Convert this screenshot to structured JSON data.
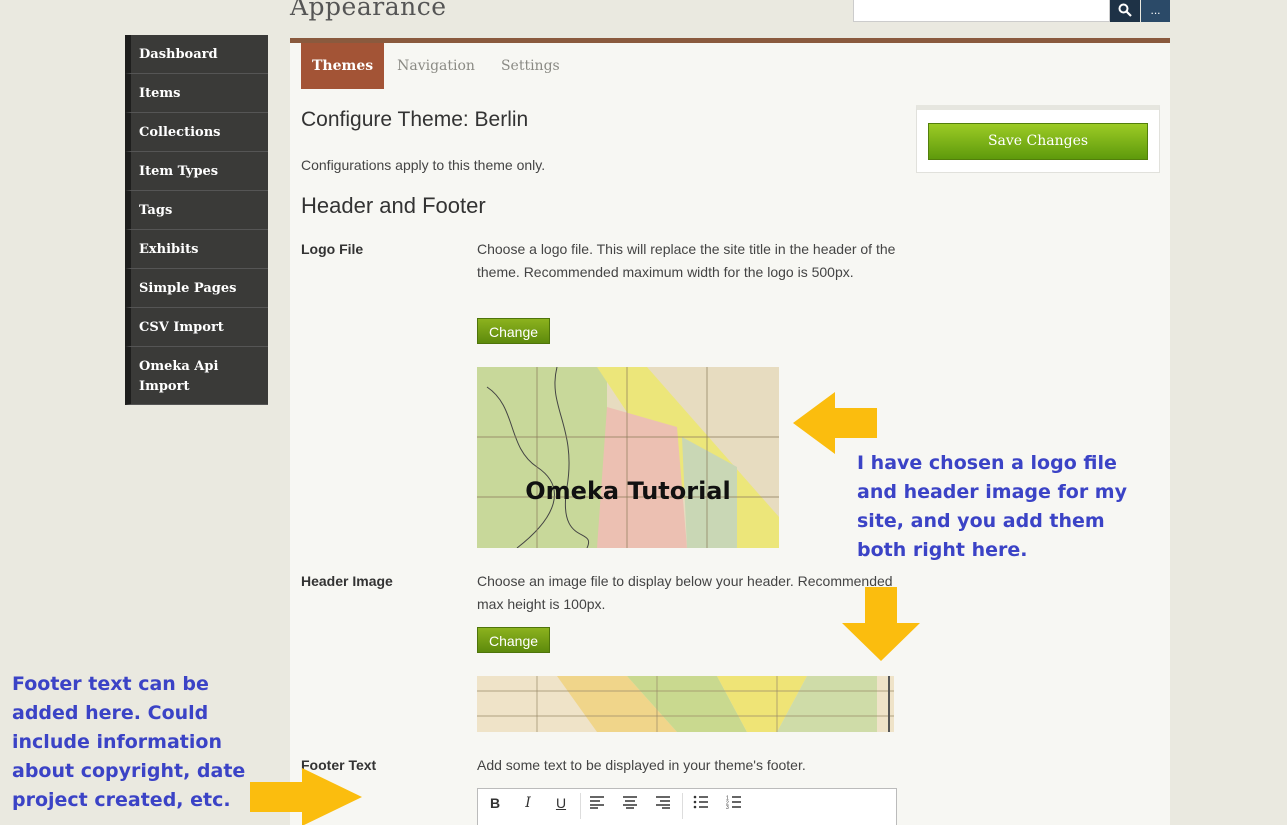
{
  "header": {
    "title": "Appearance",
    "search_placeholder": "",
    "advanced_label": "..."
  },
  "sidebar": {
    "items": [
      {
        "label": "Dashboard"
      },
      {
        "label": "Items"
      },
      {
        "label": "Collections"
      },
      {
        "label": "Item Types"
      },
      {
        "label": "Tags"
      },
      {
        "label": "Exhibits"
      },
      {
        "label": "Simple Pages"
      },
      {
        "label": "CSV Import"
      },
      {
        "label": "Omeka Api Import"
      }
    ]
  },
  "tabs": [
    {
      "label": "Themes",
      "active": true
    },
    {
      "label": "Navigation",
      "active": false
    },
    {
      "label": "Settings",
      "active": false
    }
  ],
  "main": {
    "title": "Configure Theme: Berlin",
    "description": "Configurations apply to this theme only.",
    "section_heading": "Header and Footer",
    "logo_file": {
      "label": "Logo File",
      "help": "Choose a logo file. This will replace the site title in the header of the theme. Recommended maximum width for the logo is 500px.",
      "button": "Change",
      "image_caption": "Omeka Tutorial"
    },
    "header_image": {
      "label": "Header Image",
      "help": "Choose an image file to display below your header. Recommended max height is 100px.",
      "button": "Change"
    },
    "footer_text": {
      "label": "Footer Text",
      "help": "Add some text to be displayed in your theme's footer."
    }
  },
  "save": {
    "label": "Save Changes"
  },
  "editor_toolbar": [
    "bold",
    "italic",
    "underline",
    "align-left",
    "align-center",
    "align-right",
    "bullet-list",
    "numbered-list"
  ],
  "annotations": {
    "right_note": "I have chosen a logo file and header image for my site, and you add them both right here.",
    "left_note": "Footer text can be added here. Could include information about copyright, date project created, etc."
  },
  "colors": {
    "accent_tab": "#a35436",
    "panel_border": "#8a5a3e",
    "save_green": "#7cb51a",
    "annotation_blue": "#3b43c6",
    "arrow_yellow": "#fbbd0e"
  }
}
